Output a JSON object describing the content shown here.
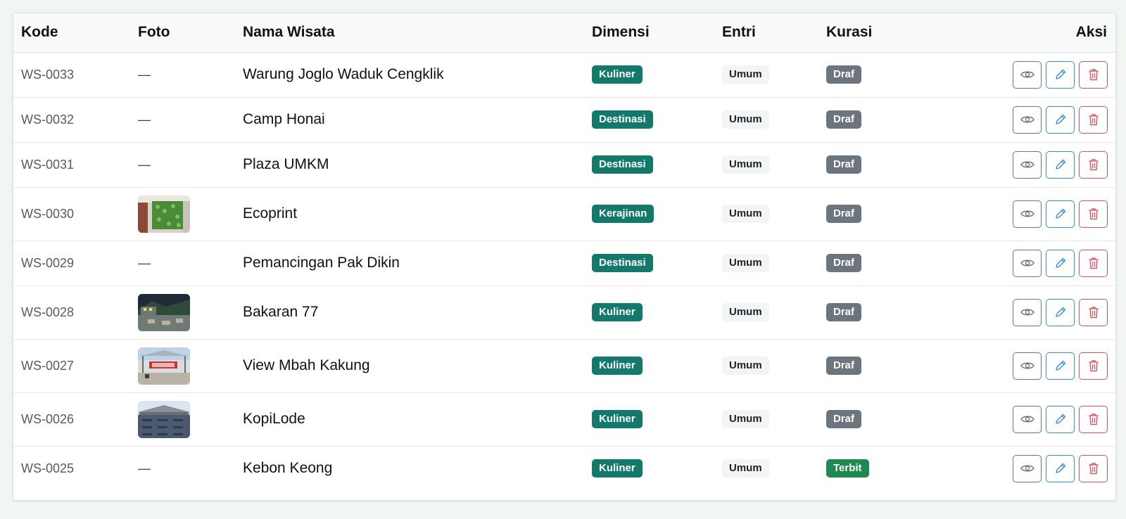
{
  "table": {
    "headers": {
      "kode": "Kode",
      "foto": "Foto",
      "nama": "Nama Wisata",
      "dimensi": "Dimensi",
      "entri": "Entri",
      "kurasi": "Kurasi",
      "aksi": "Aksi"
    },
    "rows": [
      {
        "kode": "WS-0033",
        "foto": "—",
        "nama": "Warung Joglo Waduk Cengklik",
        "dimensi": "Kuliner",
        "entri": "Umum",
        "kurasi": "Draf"
      },
      {
        "kode": "WS-0032",
        "foto": "—",
        "nama": "Camp Honai",
        "dimensi": "Destinasi",
        "entri": "Umum",
        "kurasi": "Draf"
      },
      {
        "kode": "WS-0031",
        "foto": "—",
        "nama": "Plaza UMKM",
        "dimensi": "Destinasi",
        "entri": "Umum",
        "kurasi": "Draf"
      },
      {
        "kode": "WS-0030",
        "foto": "",
        "nama": "Ecoprint",
        "dimensi": "Kerajinan",
        "entri": "Umum",
        "kurasi": "Draf"
      },
      {
        "kode": "WS-0029",
        "foto": "—",
        "nama": "Pemancingan Pak Dikin",
        "dimensi": "Destinasi",
        "entri": "Umum",
        "kurasi": "Draf"
      },
      {
        "kode": "WS-0028",
        "foto": "",
        "nama": "Bakaran 77",
        "dimensi": "Kuliner",
        "entri": "Umum",
        "kurasi": "Draf"
      },
      {
        "kode": "WS-0027",
        "foto": "",
        "nama": "View Mbah Kakung",
        "dimensi": "Kuliner",
        "entri": "Umum",
        "kurasi": "Draf"
      },
      {
        "kode": "WS-0026",
        "foto": "",
        "nama": "KopiLode",
        "dimensi": "Kuliner",
        "entri": "Umum",
        "kurasi": "Draf"
      },
      {
        "kode": "WS-0025",
        "foto": "—",
        "nama": "Kebon Keong",
        "dimensi": "Kuliner",
        "entri": "Umum",
        "kurasi": "Terbit"
      }
    ]
  },
  "icons": {
    "view": "eye-icon",
    "edit": "pencil-icon",
    "delete": "trash-icon"
  },
  "colors": {
    "dimensi_badge": "#137a6b",
    "draf_badge": "#6c757d",
    "terbit_badge": "#1e8a50",
    "edit_button": "#3d8bd9",
    "delete_button": "#d9535f"
  }
}
